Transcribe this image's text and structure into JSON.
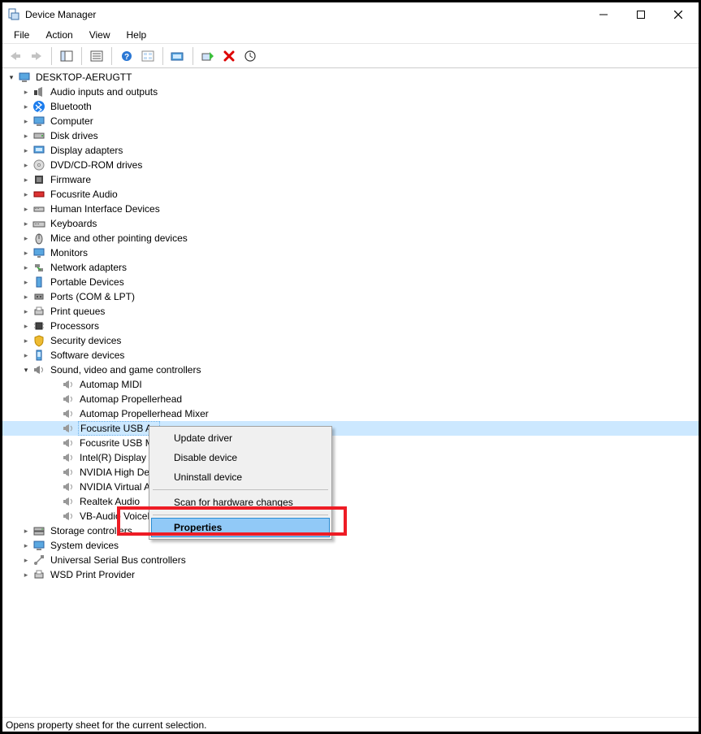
{
  "window": {
    "title": "Device Manager"
  },
  "menubar": {
    "file": "File",
    "action": "Action",
    "view": "View",
    "help": "Help"
  },
  "tree": {
    "root": "DESKTOP-AERUGTT",
    "categories": [
      "Audio inputs and outputs",
      "Bluetooth",
      "Computer",
      "Disk drives",
      "Display adapters",
      "DVD/CD-ROM drives",
      "Firmware",
      "Focusrite Audio",
      "Human Interface Devices",
      "Keyboards",
      "Mice and other pointing devices",
      "Monitors",
      "Network adapters",
      "Portable Devices",
      "Ports (COM & LPT)",
      "Print queues",
      "Processors",
      "Security devices",
      "Software devices",
      "Sound, video and game controllers",
      "Storage controllers",
      "System devices",
      "Universal Serial Bus controllers",
      "WSD Print Provider"
    ],
    "sound_devices": [
      "Automap MIDI",
      "Automap Propellerhead",
      "Automap Propellerhead Mixer",
      "Focusrite USB Audio",
      "Focusrite USB MIDI",
      "Intel(R) Display Audio",
      "NVIDIA High Definition Audio",
      "NVIDIA Virtual Audio Device",
      "Realtek Audio",
      "VB-Audio VoiceMeeter"
    ],
    "selected_device_index": 3,
    "expanded_category_index": 19
  },
  "context_menu": {
    "update": "Update driver",
    "disable": "Disable device",
    "uninstall": "Uninstall device",
    "scan": "Scan for hardware changes",
    "properties": "Properties"
  },
  "status": "Opens property sheet for the current selection."
}
